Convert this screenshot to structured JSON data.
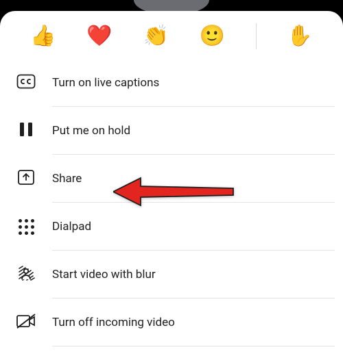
{
  "reactions": {
    "thumbs_up": "👍",
    "heart": "❤️",
    "clap": "👏",
    "smile": "🙂",
    "raise_hand": "✋"
  },
  "menu": {
    "captions": "Turn on live captions",
    "hold": "Put me on hold",
    "share": "Share",
    "dialpad": "Dialpad",
    "blur": "Start video with blur",
    "incoming_off": "Turn off incoming video"
  },
  "annotation": {
    "arrow_color": "#e2261f",
    "target": "share"
  }
}
